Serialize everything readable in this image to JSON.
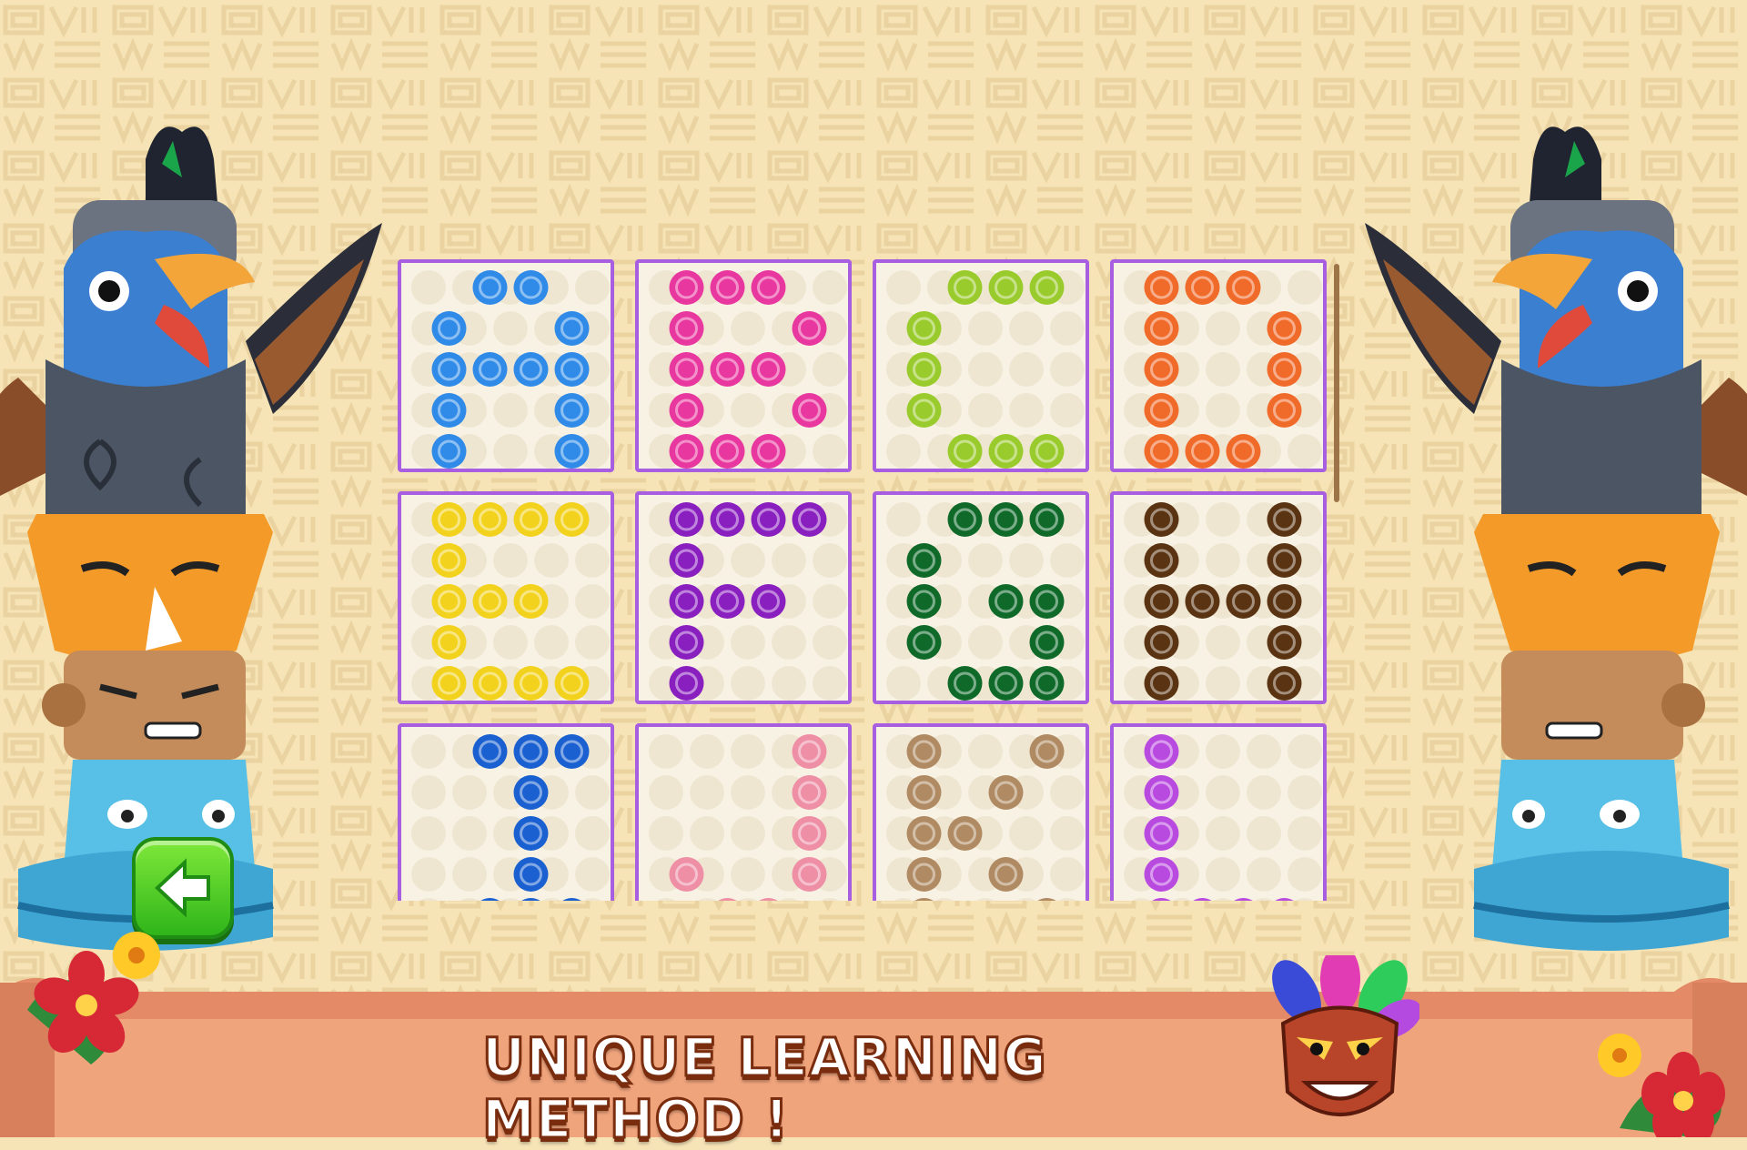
{
  "banner": {
    "text": "UNIQUE LEARNING METHOD !"
  },
  "background": {
    "color": "#f6e3b6",
    "pattern_color": "#ead3a0"
  },
  "card_frame_color": "#a85ee0",
  "back_button": {
    "icon": "arrow-left-icon",
    "color": "#3fc81f"
  },
  "letter_cards": [
    {
      "letter": "A",
      "color": "#2f8ae8"
    },
    {
      "letter": "B",
      "color": "#e8379e"
    },
    {
      "letter": "C",
      "color": "#9acb2c"
    },
    {
      "letter": "D",
      "color": "#f06a2a"
    },
    {
      "letter": "E",
      "color": "#f2d21c"
    },
    {
      "letter": "F",
      "color": "#8a1fbf"
    },
    {
      "letter": "G",
      "color": "#0f6a2a"
    },
    {
      "letter": "H",
      "color": "#5a3412"
    },
    {
      "letter": "I",
      "color": "#1a60d0"
    },
    {
      "letter": "J",
      "color": "#ee8fa6"
    },
    {
      "letter": "K",
      "color": "#b08a62"
    },
    {
      "letter": "L",
      "color": "#b94ae0"
    }
  ],
  "decorations": [
    "totem-pole-left",
    "totem-pole-right",
    "tiki-mask-icon",
    "hibiscus-flower-icon"
  ]
}
